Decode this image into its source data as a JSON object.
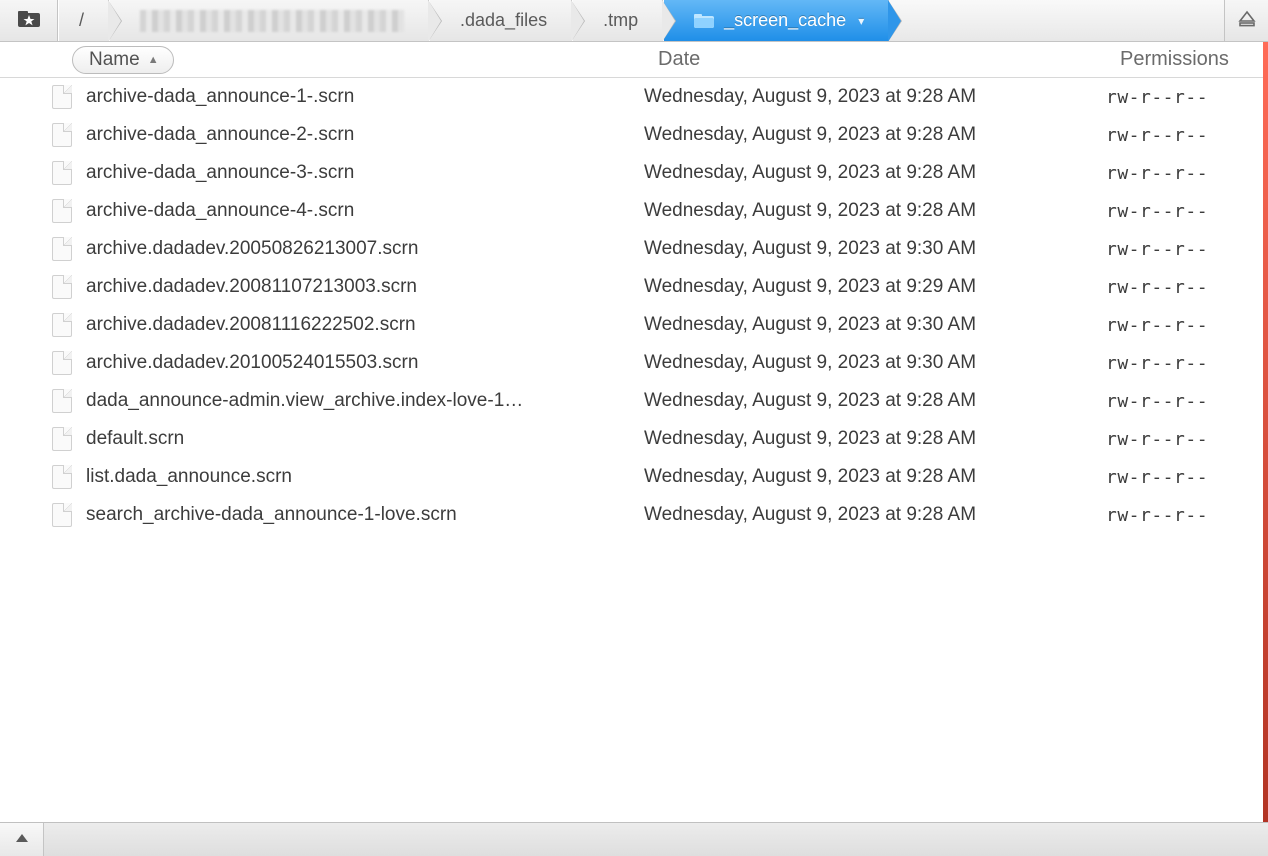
{
  "breadcrumb": {
    "root_label": "/",
    "segments": [
      {
        "label": ".dada_files"
      },
      {
        "label": ".tmp"
      }
    ],
    "active_label": "_screen_cache",
    "dropdown_glyph": "▾"
  },
  "columns": {
    "name": "Name",
    "date": "Date",
    "permissions": "Permissions",
    "sort_glyph": "▲"
  },
  "files": [
    {
      "name": "archive-dada_announce-1-.scrn",
      "date": "Wednesday, August 9, 2023 at 9:28 AM",
      "perm": "rw-r--r--"
    },
    {
      "name": "archive-dada_announce-2-.scrn",
      "date": "Wednesday, August 9, 2023 at 9:28 AM",
      "perm": "rw-r--r--"
    },
    {
      "name": "archive-dada_announce-3-.scrn",
      "date": "Wednesday, August 9, 2023 at 9:28 AM",
      "perm": "rw-r--r--"
    },
    {
      "name": "archive-dada_announce-4-.scrn",
      "date": "Wednesday, August 9, 2023 at 9:28 AM",
      "perm": "rw-r--r--"
    },
    {
      "name": "archive.dadadev.20050826213007.scrn",
      "date": "Wednesday, August 9, 2023 at 9:30 AM",
      "perm": "rw-r--r--"
    },
    {
      "name": "archive.dadadev.20081107213003.scrn",
      "date": "Wednesday, August 9, 2023 at 9:29 AM",
      "perm": "rw-r--r--"
    },
    {
      "name": "archive.dadadev.20081116222502.scrn",
      "date": "Wednesday, August 9, 2023 at 9:30 AM",
      "perm": "rw-r--r--"
    },
    {
      "name": "archive.dadadev.20100524015503.scrn",
      "date": "Wednesday, August 9, 2023 at 9:30 AM",
      "perm": "rw-r--r--"
    },
    {
      "name": "dada_announce-admin.view_archive.index-love-1…",
      "date": "Wednesday, August 9, 2023 at 9:28 AM",
      "perm": "rw-r--r--"
    },
    {
      "name": "default.scrn",
      "date": "Wednesday, August 9, 2023 at 9:28 AM",
      "perm": "rw-r--r--"
    },
    {
      "name": "list.dada_announce.scrn",
      "date": "Wednesday, August 9, 2023 at 9:28 AM",
      "perm": "rw-r--r--"
    },
    {
      "name": "search_archive-dada_announce-1-love.scrn",
      "date": "Wednesday, August 9, 2023 at 9:28 AM",
      "perm": "rw-r--r--"
    }
  ]
}
